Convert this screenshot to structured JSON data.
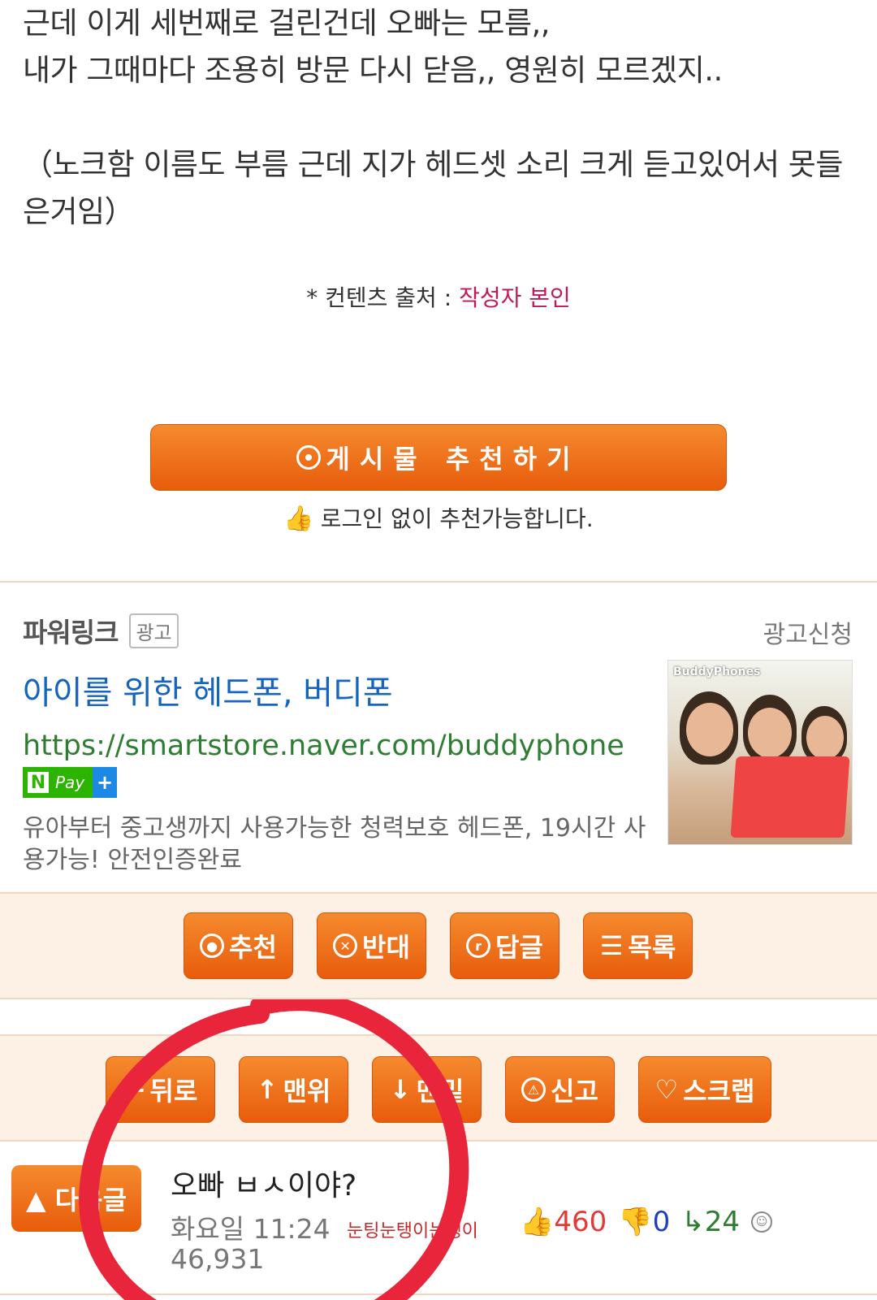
{
  "post": {
    "line1": "근데 이게 세번째로 걸린건데 오빠는 모름,,",
    "line2": "내가 그때마다 조용히 방문 다시 닫음,, 영원히 모르겠지..",
    "line3": "（노크함 이름도 부름 근데 지가 헤드셋 소리 크게 듣고있어서 못들은거임）",
    "source_label": "* 컨텐츠 출처 : ",
    "source_value": "작성자 본인"
  },
  "recommend": {
    "button_label": "게시물 추천하기",
    "note": "로그인 없이 추천가능합니다."
  },
  "powerlink": {
    "title": "파워링크",
    "badge": "광고",
    "request": "광고신청",
    "ad_title": "아이를 위한 헤드폰, 버디폰",
    "ad_url": "https://smartstore.naver.com/buddyphone",
    "npay_n": "N",
    "npay_pay": "Pay",
    "npay_plus": "+",
    "ad_desc": "유아부터 중고생까지 사용가능한 청력보호 헤드폰, 19시간 사용가능! 안전인증완료",
    "image_brand": "BuddyPhones"
  },
  "actions": {
    "recommend": "추천",
    "oppose": "반대",
    "reply": "답글",
    "list": "목록"
  },
  "nav": {
    "back": "뒤로",
    "top": "맨위",
    "bottom": "맨밑",
    "report": "신고",
    "scrap": "스크랩"
  },
  "next_post": {
    "button_label": "▲ 다음글",
    "title": "오빠 ㅂㅅ이야?",
    "time": "화요일 11:24",
    "author": "눈팅눈탱이눈탱이",
    "likes": "460",
    "dislikes": "0",
    "replies": "24",
    "views": "46,931"
  },
  "colors": {
    "accent": "#e8650f",
    "panel": "#fdf1e6",
    "link_blue": "#1565c0",
    "url_green": "#2e7d32",
    "annotation_red": "#e8253a"
  }
}
